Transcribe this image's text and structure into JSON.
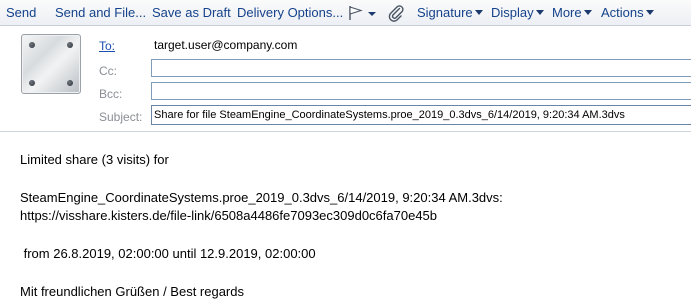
{
  "toolbar": {
    "send_label": "Send",
    "send_and_file_label": "Send and File...",
    "save_as_draft_label": "Save as Draft",
    "delivery_options_label": "Delivery Options...",
    "signature_label": "Signature",
    "display_label": "Display",
    "more_label": "More",
    "actions_label": "Actions",
    "icons": [
      "flag-icon",
      "paperclip-icon",
      "chevron-down-icon"
    ]
  },
  "header": {
    "to_label": "To:",
    "to_value": "target.user@company.com",
    "cc_label": "Cc:",
    "cc_value": "",
    "bcc_label": "Bcc:",
    "bcc_value": "",
    "subject_label": "Subject:",
    "subject_value": "Share for file SteamEngine_CoordinateSystems.proe_2019_0.3dvs_6/14/2019, 9:20:34 AM.3dvs"
  },
  "body": {
    "line1": "Limited share (3 visits) for",
    "line2": "SteamEngine_CoordinateSystems.proe_2019_0.3dvs_6/14/2019, 9:20:34 AM.3dvs:",
    "line3": "https://visshare.kisters.de/file-link/6508a4486fe7093ec309d0c6fa70e45b",
    "line4": " from 26.8.2019, 02:00:00 until 12.9.2019, 02:00:00",
    "line5": "Mit freundlichen Grüßen / Best regards"
  },
  "colors": {
    "toolbar_text": "#15428b",
    "label_gray": "#8a8f96",
    "link_blue": "#1a4fb0",
    "field_border": "#7f9db9"
  }
}
